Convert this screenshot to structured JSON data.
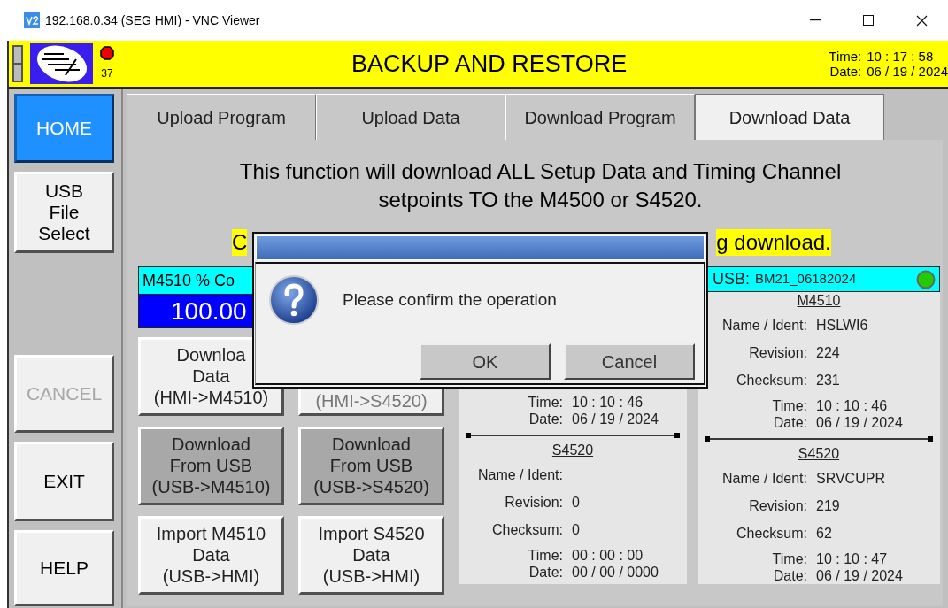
{
  "window": {
    "title": "192.168.0.34 (SEG HMI) - VNC Viewer"
  },
  "header": {
    "title": "BACKUP AND RESTORE",
    "alarm_count": "37",
    "time_label": "Time:",
    "time": "10 : 17 : 58",
    "date_label": "Date:",
    "date": "06 / 19 / 2024"
  },
  "sidebar": {
    "top": [
      {
        "lines": [
          "HOME"
        ],
        "selected": true,
        "disabled": false
      },
      {
        "lines": [
          "USB",
          "File",
          "Select"
        ],
        "selected": false,
        "disabled": false
      }
    ],
    "bottom": [
      {
        "lines": [
          "CANCEL"
        ],
        "selected": false,
        "disabled": true
      },
      {
        "lines": [
          "EXIT"
        ],
        "selected": false,
        "disabled": false
      },
      {
        "lines": [
          "HELP"
        ],
        "selected": false,
        "disabled": false
      }
    ]
  },
  "tabs": [
    {
      "label": "Upload Program",
      "selected": false
    },
    {
      "label": "Upload Data",
      "selected": false
    },
    {
      "label": "Download Program",
      "selected": false
    },
    {
      "label": "Download Data",
      "selected": true
    }
  ],
  "message": "This function will download ALL Setup Data and Timing Channel setpoints TO the M4500 or S4520.",
  "warning": {
    "left": "C",
    "right": "g download."
  },
  "progress": {
    "label": "M4510 % Co",
    "value": "100.00"
  },
  "action_buttons": [
    {
      "lines": [
        "Downloa",
        "Data",
        "(HMI->M4510)"
      ],
      "kind": "plain",
      "disabled": false
    },
    {
      "lines": [
        "(HMI->S4520)"
      ],
      "kind": "plain",
      "disabled": true
    },
    {
      "lines": [
        "Download",
        "From USB",
        "(USB->M4510)"
      ],
      "kind": "shaded",
      "disabled": false
    },
    {
      "lines": [
        "Download",
        "From USB",
        "(USB->S4520)"
      ],
      "kind": "shaded",
      "disabled": false
    },
    {
      "lines": [
        "Import M4510",
        "Data",
        "(USB->HMI)"
      ],
      "kind": "plain",
      "disabled": false
    },
    {
      "lines": [
        "Import S4520",
        "Data",
        "(USB->HMI)"
      ],
      "kind": "plain",
      "disabled": false
    }
  ],
  "usb": {
    "label": "USB:",
    "name": "BM21_06182024",
    "connected": true
  },
  "panels": [
    {
      "sections": [
        {
          "stamp": [
            {
              "label": "Time:",
              "value": "10 : 10 : 46"
            },
            {
              "label": "Date:",
              "value": "06 / 19 / 2024"
            }
          ]
        },
        {
          "title": "S4520",
          "fields": [
            {
              "label": "Name / Ident:"
            },
            {
              "label": "Revision:",
              "value": "0"
            },
            {
              "label": "Checksum:",
              "value": "0"
            }
          ],
          "stamp": [
            {
              "label": "Time:",
              "value": "00 : 00 : 00"
            },
            {
              "label": "Date:",
              "value": "00 / 00 / 0000"
            }
          ]
        }
      ]
    },
    {
      "sections": [
        {
          "title": "M4510",
          "fields": [
            {
              "label": "Name / Ident:",
              "value": "HSLWI6"
            },
            {
              "label": "Revision:",
              "value": "224"
            },
            {
              "label": "Checksum:",
              "value": "231"
            }
          ],
          "stamp": [
            {
              "label": "Time:",
              "value": "10 : 10 : 46"
            },
            {
              "label": "Date:",
              "value": "06 / 19 / 2024"
            }
          ]
        },
        {
          "title": "S4520",
          "fields": [
            {
              "label": "Name / Ident:",
              "value": "SRVCUPR"
            },
            {
              "label": "Revision:",
              "value": "219"
            },
            {
              "label": "Checksum:",
              "value": "62"
            }
          ],
          "stamp": [
            {
              "label": "Time:",
              "value": "10 : 10 : 47"
            },
            {
              "label": "Date:",
              "value": "06 / 19 / 2024"
            }
          ]
        }
      ]
    }
  ],
  "dialog": {
    "message": "Please confirm the operation",
    "buttons": [
      "OK",
      "Cancel"
    ]
  }
}
